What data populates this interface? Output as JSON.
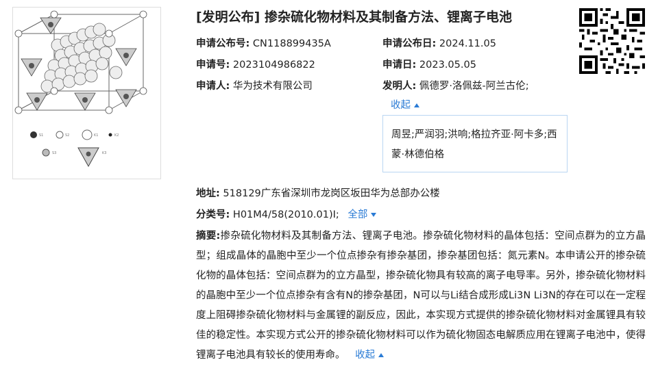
{
  "title": "[发明公布] 掺杂硫化物材料及其制备方法、锂离子电池",
  "fields": {
    "pub_no_label": "申请公布号:",
    "pub_no": "CN118899435A",
    "pub_date_label": "申请公布日:",
    "pub_date": "2024.11.05",
    "app_no_label": "申请号:",
    "app_no": "2023104986822",
    "app_date_label": "申请日:",
    "app_date": "2023.05.05",
    "applicant_label": "申请人:",
    "applicant": "华为技术有限公司",
    "inventor_label": "发明人:",
    "inventor": "佩德罗·洛佩兹-阿兰古伦;",
    "inventor_more": "周昱;严润羽;洪响;格拉齐亚·阿卡多;西蒙·林德伯格",
    "collapse_label": "收起",
    "address_label": "地址:",
    "address": "518129广东省深圳市龙岗区坂田华为总部办公楼",
    "class_label": "分类号:",
    "class_value": "H01M4/58(2010.01)I;",
    "class_all_label": "全部",
    "abstract_label": "摘要:",
    "abstract": "掺杂硫化物材料及其制备方法、锂离子电池。掺杂硫化物材料的晶体包括：空间点群为的立方晶型；组成晶体的晶胞中至少一个位点掺杂有掺杂基团，掺杂基团包括：氮元素N。本申请公开的掺杂硫化物的晶体包括：空间点群为的立方晶型，掺杂硫化物具有较高的离子电导率。另外，掺杂硫化物材料的晶胞中至少一个位点掺杂有含有N的掺杂基团，N可以与Li结合成形成Li3N Li3N的存在可以在一定程度上阻碍掺杂硫化物材料与金属锂的副反应，因此，本实现方式提供的掺杂硫化物材料对金属锂具有较佳的稳定性。本实现方式公开的掺杂硫化物材料可以作为硫化物固态电解质应用在锂离子电池中，使得锂离子电池具有较长的使用寿命。",
    "abstract_collapse_label": "收起"
  },
  "figure": {
    "legend": [
      "S1",
      "S2",
      "K1",
      "K2",
      "S3",
      "K3"
    ]
  },
  "colors": {
    "link": "#2a7bd5",
    "popup_border": "#b9d6f2"
  }
}
